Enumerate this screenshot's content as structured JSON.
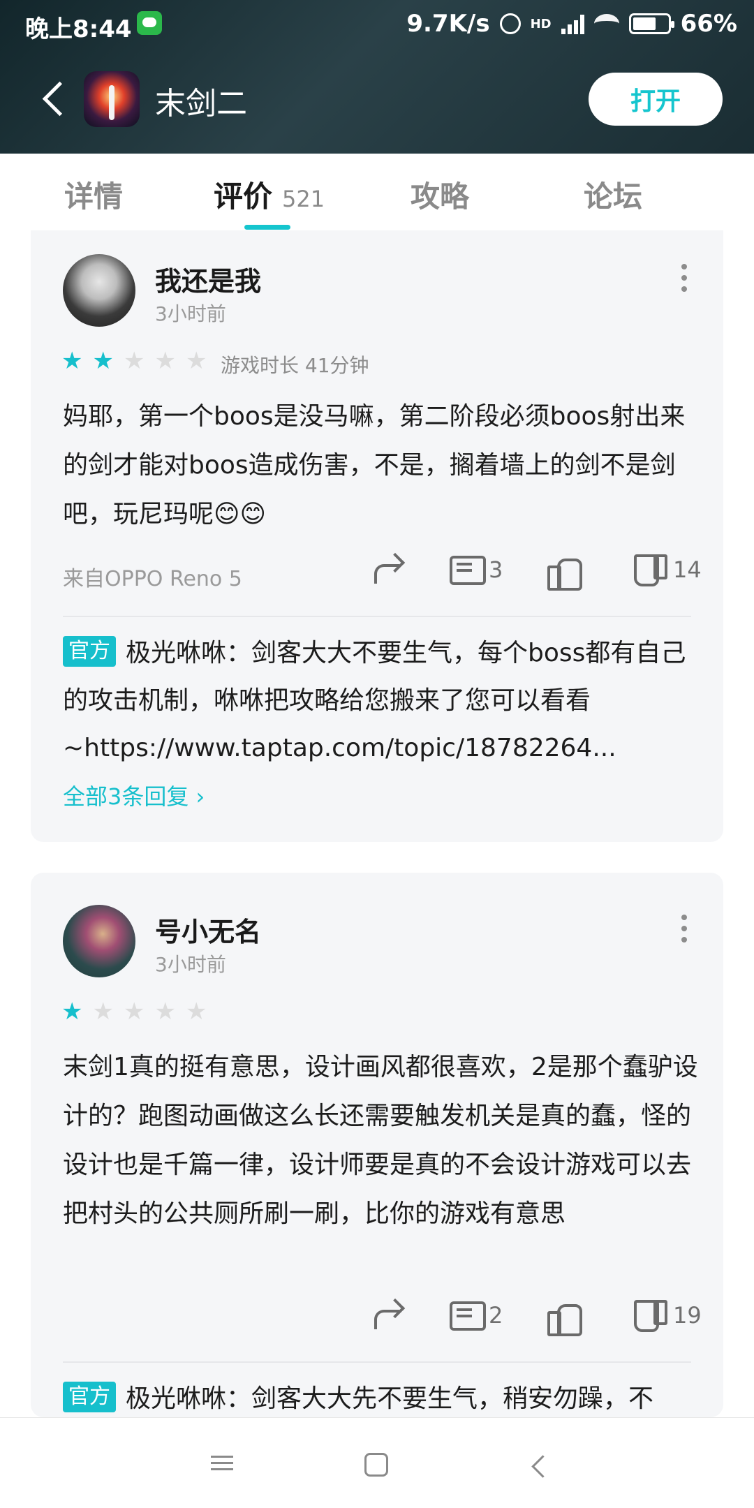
{
  "status_bar": {
    "time": "晚上8:44",
    "network_speed": "9.7K/s",
    "network_type": "HD",
    "battery": "66%"
  },
  "header": {
    "back_icon": "chevron-left-icon",
    "app_name": "末剑二",
    "open_label": "打开"
  },
  "tabs": [
    {
      "label": "详情",
      "active": false
    },
    {
      "label": "评价",
      "count": "521",
      "active": true
    },
    {
      "label": "攻略",
      "active": false
    },
    {
      "label": "论坛",
      "active": false
    }
  ],
  "reviews": [
    {
      "username": "我还是我",
      "time": "3小时前",
      "rating": 2,
      "stars": [
        "★",
        "★",
        "★",
        "★",
        "★"
      ],
      "playtime": "游戏时长 41分钟",
      "content": "妈耶，第一个boos是没马嘛，第二阶段必须boos射出来的剑才能对boos造成伤害，不是，搁着墙上的剑不是剑吧，玩尼玛呢😊😊",
      "device": "来自OPPO Reno 5",
      "comments": "3",
      "dislikes": "14",
      "reply": {
        "badge": "官方",
        "author": "极光咻咻",
        "text": "剑客大大不要生气，每个boss都有自己的攻击机制，咻咻把攻略给您搬来了您可以看看~https://www.taptap.com/topic/18782264...",
        "more_label": "全部3条回复 ›"
      }
    },
    {
      "username": "号小无名",
      "time": "3小时前",
      "rating": 1,
      "stars": [
        "★",
        "★",
        "★",
        "★",
        "★"
      ],
      "content": "末剑1真的挺有意思，设计画风都很喜欢，2是那个蠢驴设计的？跑图动画做这么长还需要触发机关是真的蠢，怪的设计也是千篇一律，设计师要是真的不会设计游戏可以去把村头的公共厕所刷一刷，比你的游戏有意思",
      "comments": "2",
      "dislikes": "19",
      "reply": {
        "badge": "官方",
        "author": "极光咻咻",
        "text": "剑客大大先不要生气，稍安勿躁，不"
      }
    }
  ],
  "colors": {
    "accent": "#16bfcc",
    "header_bg": "#1d3238",
    "card_bg": "#f5f6f8"
  }
}
